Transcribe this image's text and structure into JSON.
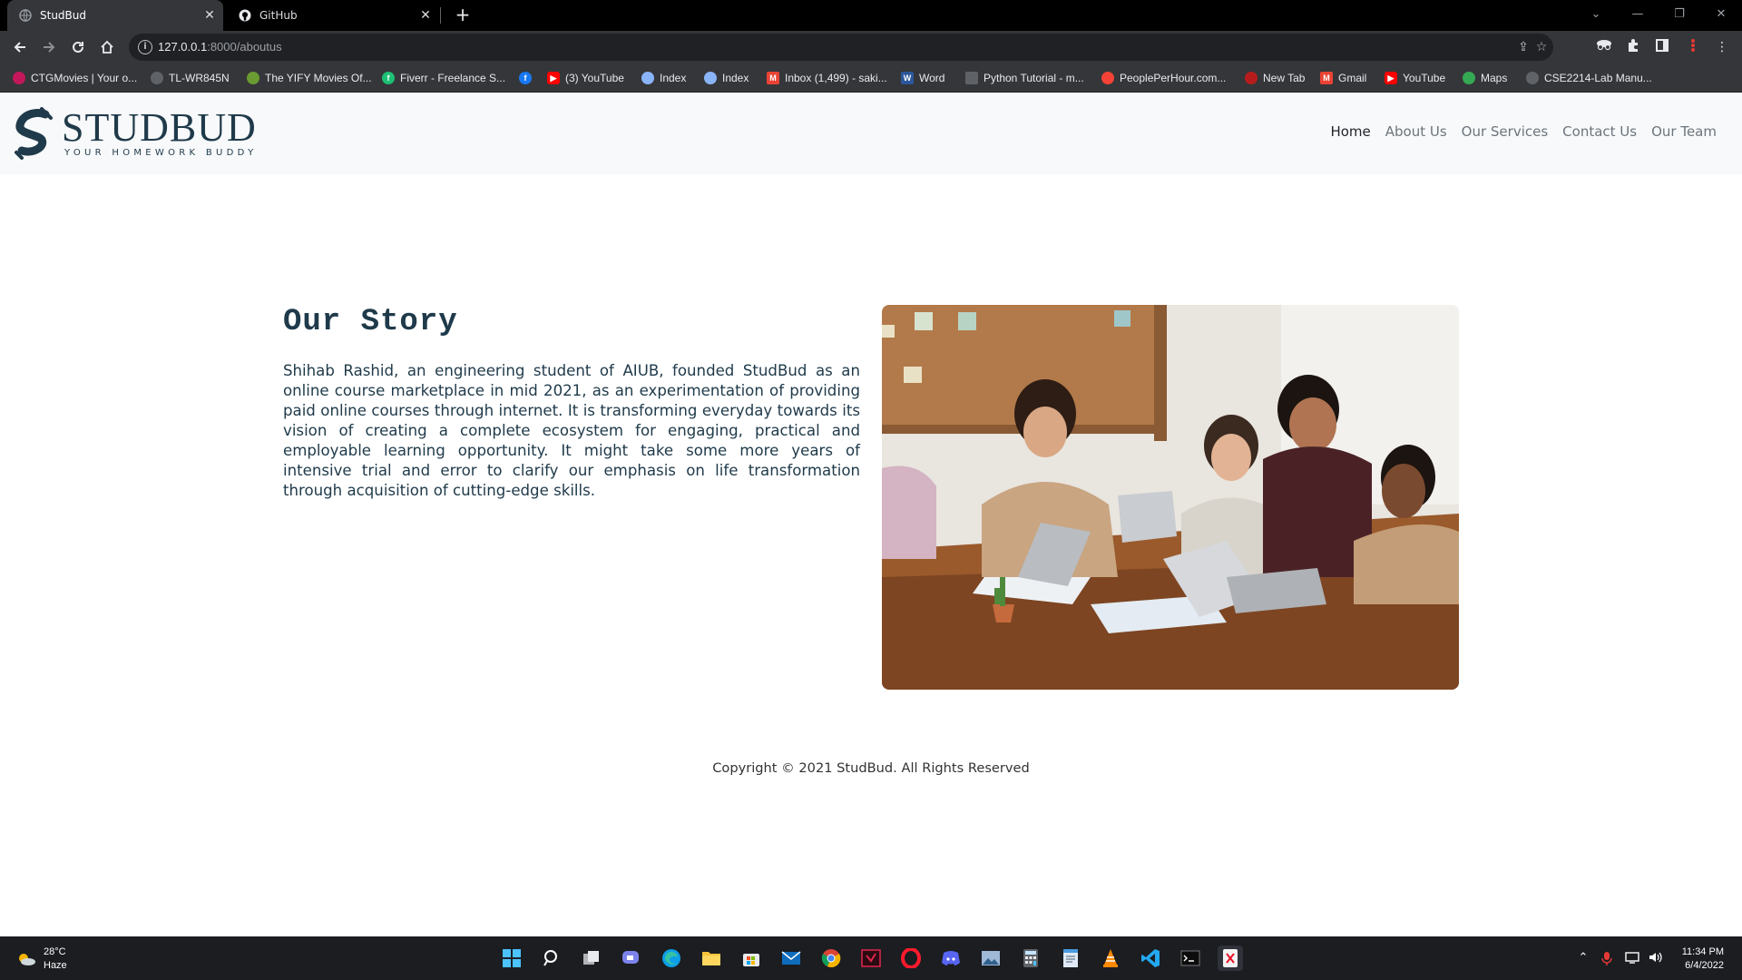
{
  "browser": {
    "tabs": [
      {
        "title": "StudBud",
        "active": true
      },
      {
        "title": "GitHub",
        "active": false
      }
    ],
    "url_host": "127.0.0.1",
    "url_path": ":8000/aboutus",
    "bookmarks": [
      {
        "label": "CTGMovies | Your o...",
        "color": "#c2185b"
      },
      {
        "label": "TL-WR845N",
        "color": "#e8eaed"
      },
      {
        "label": "The YIFY Movies Of...",
        "color": "#6a9b32"
      },
      {
        "label": "Fiverr - Freelance S...",
        "color": "#1dbf73"
      },
      {
        "label": "",
        "color": "#1877f2"
      },
      {
        "label": "(3) YouTube",
        "color": "#ff0000"
      },
      {
        "label": "Index",
        "color": "#8ab4f8"
      },
      {
        "label": "Index",
        "color": "#8ab4f8"
      },
      {
        "label": "Inbox (1,499) - saki...",
        "color": "#ea4335"
      },
      {
        "label": "Word",
        "color": "#2b579a"
      },
      {
        "label": "Python Tutorial - m...",
        "color": "#5f6368"
      },
      {
        "label": "PeoplePerHour.com...",
        "color": "#f44336"
      },
      {
        "label": "New Tab",
        "color": "#b71c1c"
      },
      {
        "label": "Gmail",
        "color": "#ea4335"
      },
      {
        "label": "YouTube",
        "color": "#ff0000"
      },
      {
        "label": "Maps",
        "color": "#34a853"
      },
      {
        "label": "CSE2214-Lab Manu...",
        "color": "#e8eaed"
      }
    ]
  },
  "site": {
    "logo_name": "STUDBUD",
    "logo_tagline": "YOUR HOMEWORK BUDDY",
    "nav": [
      {
        "label": "Home",
        "active": true
      },
      {
        "label": "About Us",
        "active": false
      },
      {
        "label": "Our Services",
        "active": false
      },
      {
        "label": "Contact Us",
        "active": false
      },
      {
        "label": "Our Team",
        "active": false
      }
    ],
    "story_title": "Our Story",
    "story_text": "Shihab Rashid, an engineering student of AIUB, founded StudBud as an online course marketplace in mid 2021, as an experimentation of providing paid online courses through internet. It is transforming everyday towards its vision of creating a complete ecosystem for engaging, practical and employable learning opportunity. It might take some more years of intensive trial and error to clarify our emphasis on life transformation through acquisition of cutting-edge skills.",
    "copyright": "Copyright © 2021 StudBud. All Rights Reserved",
    "brand_color": "#1f3a4a"
  },
  "taskbar": {
    "temperature": "28°C",
    "condition": "Haze",
    "time": "11:34 PM",
    "date": "6/4/2022"
  }
}
